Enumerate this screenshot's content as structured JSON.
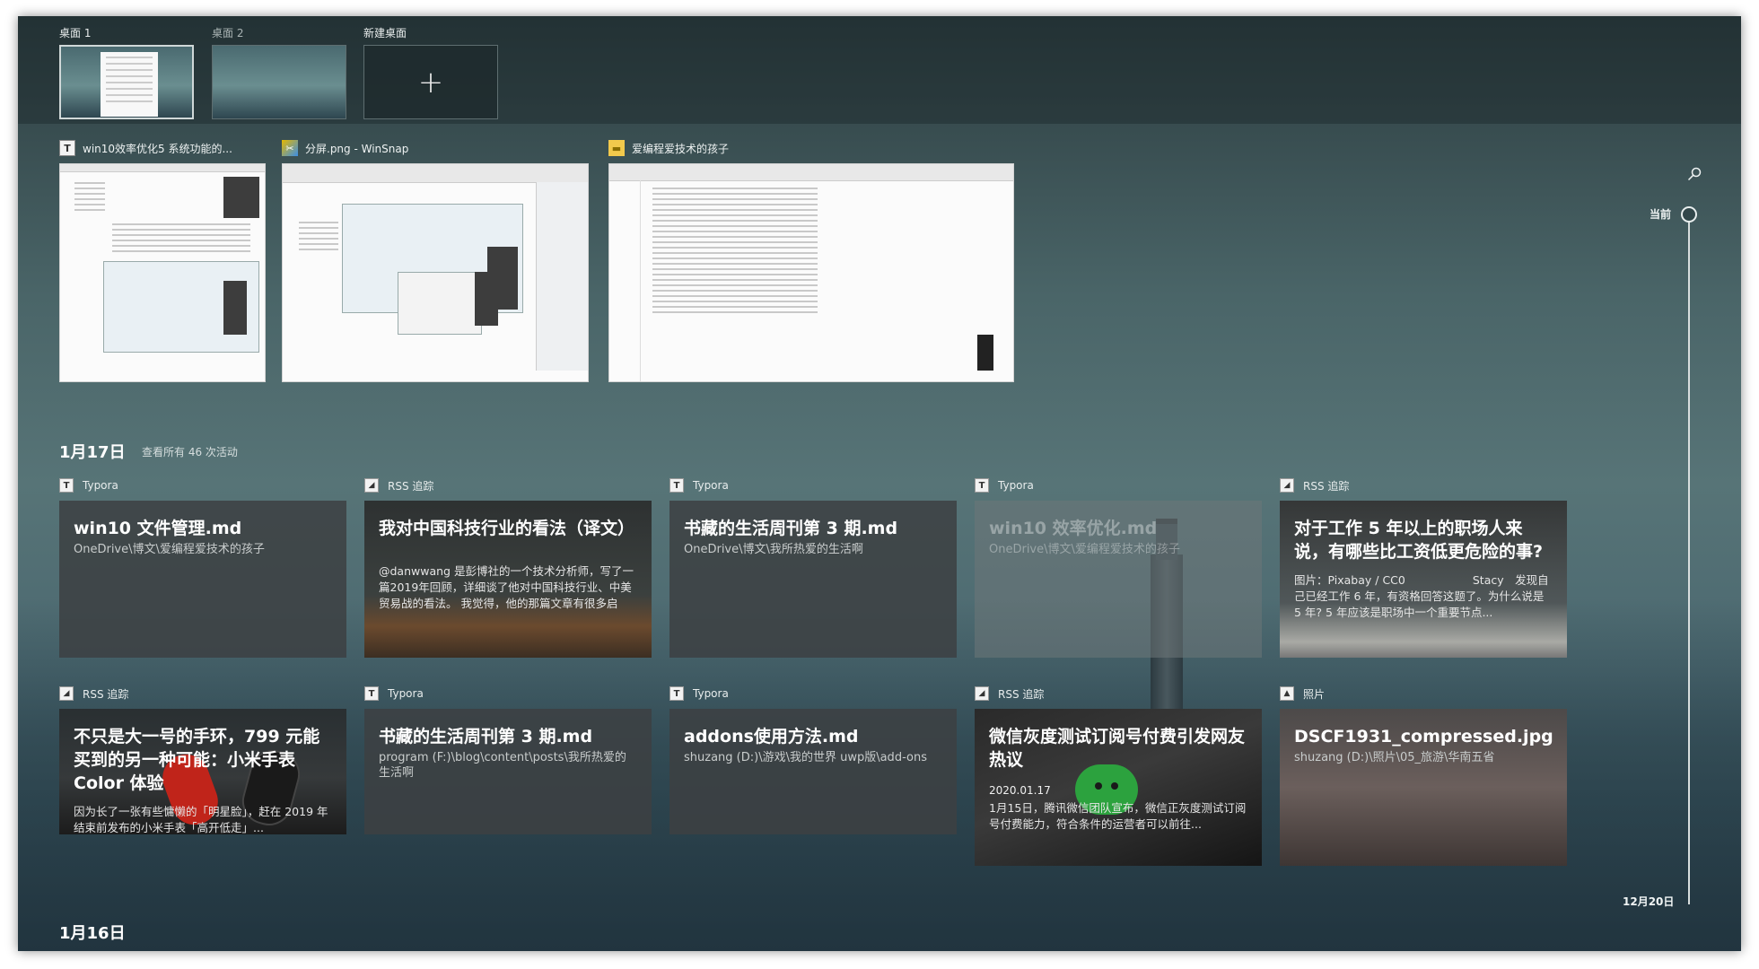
{
  "desktops": [
    {
      "label": "桌面 1",
      "active": true
    },
    {
      "label": "桌面 2",
      "active": false
    },
    {
      "label": "新建桌面",
      "plus": "+"
    }
  ],
  "windows": [
    {
      "title": "win10效率优化5 系统功能的...",
      "app_icon": "typora-icon",
      "icon_glyph": "T"
    },
    {
      "title": "分屏.png - WinSnap",
      "app_icon": "winsnap-icon",
      "icon_glyph": "✂"
    },
    {
      "title": "爱编程爱技术的孩子",
      "app_icon": "folder-icon",
      "icon_glyph": "▬"
    }
  ],
  "timeline": {
    "now_label": "当前",
    "end_label": "12月20日"
  },
  "sections": [
    {
      "date": "1月17日",
      "view_all": "查看所有 46 次活动",
      "rows": [
        [
          {
            "app": "Typora",
            "title": "win10 文件管理.md",
            "sub": "OneDrive\\博文\\爱编程爱技术的孩子"
          },
          {
            "app": "RSS 追踪",
            "title": "我对中国科技行业的看法（译文）",
            "desc": "@danwwang 是彭博社的一个技术分析师，写了一篇2019年回顾，详细谈了他对中国科技行业、中美贸易战的看法。 我觉得，他的那篇文章有很多启发，总体比较客观，中国的劣势和..."
          },
          {
            "app": "Typora",
            "title": "书藏的生活周刊第 3 期.md",
            "sub": "OneDrive\\博文\\我所热爱的生活啊"
          },
          {
            "app": "Typora",
            "title": "win10 效率优化.md",
            "sub": "OneDrive\\博文\\爱编程爱技术的孩子"
          },
          {
            "app": "RSS 追踪",
            "title": "对于工作 5 年以上的职场人来说，有哪些比工资低更危险的事?",
            "desc": "图片：Pixabay / CC0　　　　　　Stacy　发现自己已经工作 6 年，有资格回答这题了。为什么说是 5 年? 5 年应该是职场中一个重要节点..."
          }
        ],
        [
          {
            "app": "RSS 追踪",
            "title": "不只是大一号的手环，799 元能买到的另一种可能：小米手表 Color 体验",
            "desc": "因为长了一张有些慵懒的「明星脸」，赶在 2019 年结束前发布的小米手表「高开低走」..."
          },
          {
            "app": "Typora",
            "title": "书藏的生活周刊第 3 期.md",
            "sub": "program (F:)\\blog\\content\\posts\\我所热爱的生活啊"
          },
          {
            "app": "Typora",
            "title": "addons使用方法.md",
            "sub": "shuzang (D:)\\游戏\\我的世界 uwp版\\add-ons"
          },
          {
            "app": "RSS 追踪",
            "title": "微信灰度测试订阅号付费引发网友热议",
            "date": "2020.01.17",
            "desc": "1月15日，腾讯微信团队宣布，微信正灰度测试订阅号付费能力，符合条件的运营者可以前往..."
          },
          {
            "app": "照片",
            "title": "DSCF1931_compressed.jpg",
            "sub": "shuzang (D:)\\照片\\05_旅游\\华南五省"
          }
        ]
      ]
    },
    {
      "date": "1月16日"
    }
  ]
}
